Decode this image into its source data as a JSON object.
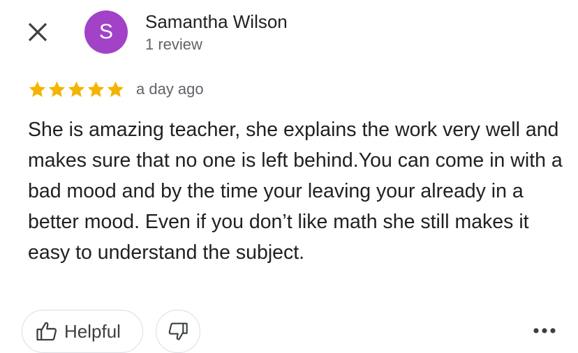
{
  "header": {
    "close_icon": "close-icon",
    "avatar_letter": "S",
    "avatar_color": "#a142c7",
    "reviewer_name": "Samantha Wilson",
    "review_count": "1 review"
  },
  "review": {
    "rating": 5,
    "rating_max": 5,
    "star_color": "#f4b400",
    "date": "a day ago",
    "text": "She is amazing teacher, she explains the work very well and makes sure that no one is left behind.You can come in with a bad mood and by the time your leaving your already in a better mood. Even if you don’t like math she still makes it easy to understand the subject."
  },
  "actions": {
    "helpful_label": "Helpful",
    "helpful_icon": "thumbs-up-icon",
    "dislike_icon": "thumbs-down-icon",
    "more_icon": "more-options-icon"
  }
}
